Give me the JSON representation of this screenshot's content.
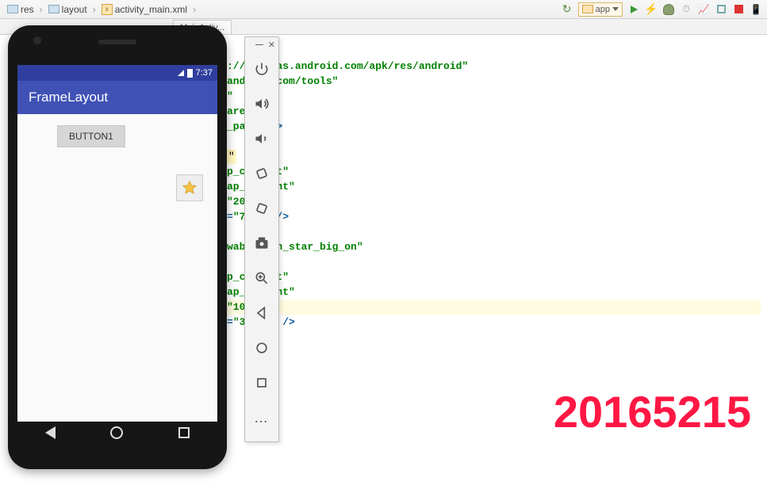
{
  "breadcrumbs": {
    "res": "res",
    "layout": "layout",
    "file": "activity_main.xml"
  },
  "open_tab": "MainActiv...",
  "run_target": "app",
  "phone": {
    "status_time": "7:37",
    "app_title": "FrameLayout",
    "button1": "BUTTON1"
  },
  "code": {
    "l1a": "://schemas.android.com/apk/res/android\"",
    "l2a": "android.com/tools\"",
    "l3a": "\"",
    "l4a": "arent\"",
    "l5a": "_parent\"",
    "l5b": ">",
    "l6a": "\"",
    "l7a": "p_content\"",
    "l8a": "ap_content\"",
    "l9a": "\"20dp\"",
    "l10a": "=",
    "l10b": "\"74dp\"",
    "l10c": " />",
    "l11a": "wable/btn_star_big_on\"",
    "l12a": "p_content\"",
    "l13a": "ap_content\"",
    "l14a": "\"100dp\"",
    "l15a": "=",
    "l15b": "\"300dp\"",
    "l15c": " />"
  },
  "watermark": "20165215"
}
